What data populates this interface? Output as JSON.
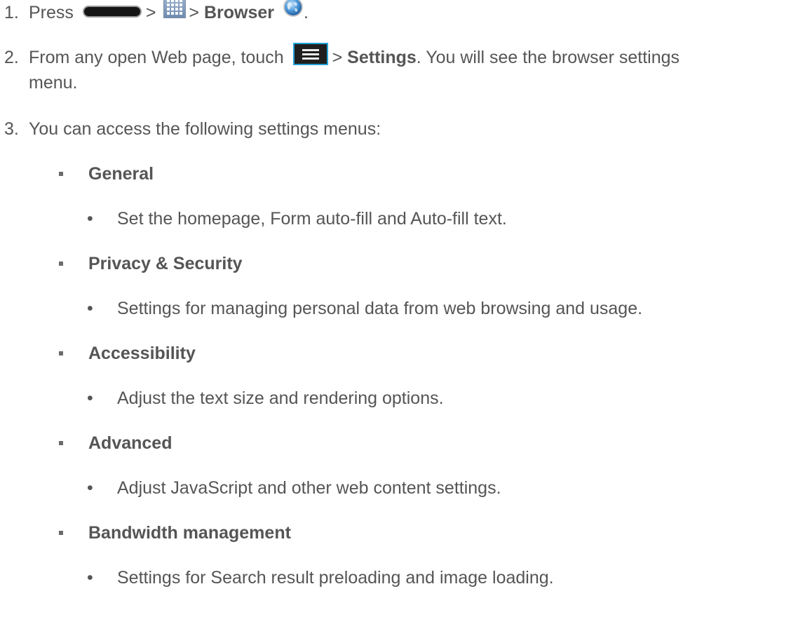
{
  "steps": [
    {
      "number": "1.",
      "parts": {
        "press": "Press",
        "sep1": ">",
        "sep2": ">",
        "browser": "Browser",
        "end": "."
      },
      "icons": [
        "home-key-icon",
        "apps-grid-icon",
        "browser-globe-icon"
      ]
    },
    {
      "number": "2.",
      "parts": {
        "lead": "From any open Web page, touch",
        "sep": ">",
        "settings": "Settings",
        "trail": ". You will see the browser settings",
        "wrap": "menu."
      },
      "icons": [
        "menu-key-icon"
      ]
    },
    {
      "number": "3.",
      "text": "You can access the following settings menus:"
    }
  ],
  "menus": [
    {
      "title": "General",
      "description": "Set the homepage, Form auto-fill and Auto-fill text."
    },
    {
      "title": "Privacy & Security",
      "description": "Settings for managing personal data from web browsing and usage."
    },
    {
      "title": "Accessibility",
      "description": "Adjust the text size and rendering options."
    },
    {
      "title": "Advanced",
      "description": "Adjust JavaScript and other web content settings."
    },
    {
      "title": "Bandwidth management",
      "description": "Settings for Search result preloading and image loading."
    }
  ],
  "bullet_dot": "•",
  "colors": {
    "text": "#555555",
    "menu_key_border": "#23a3d6"
  }
}
